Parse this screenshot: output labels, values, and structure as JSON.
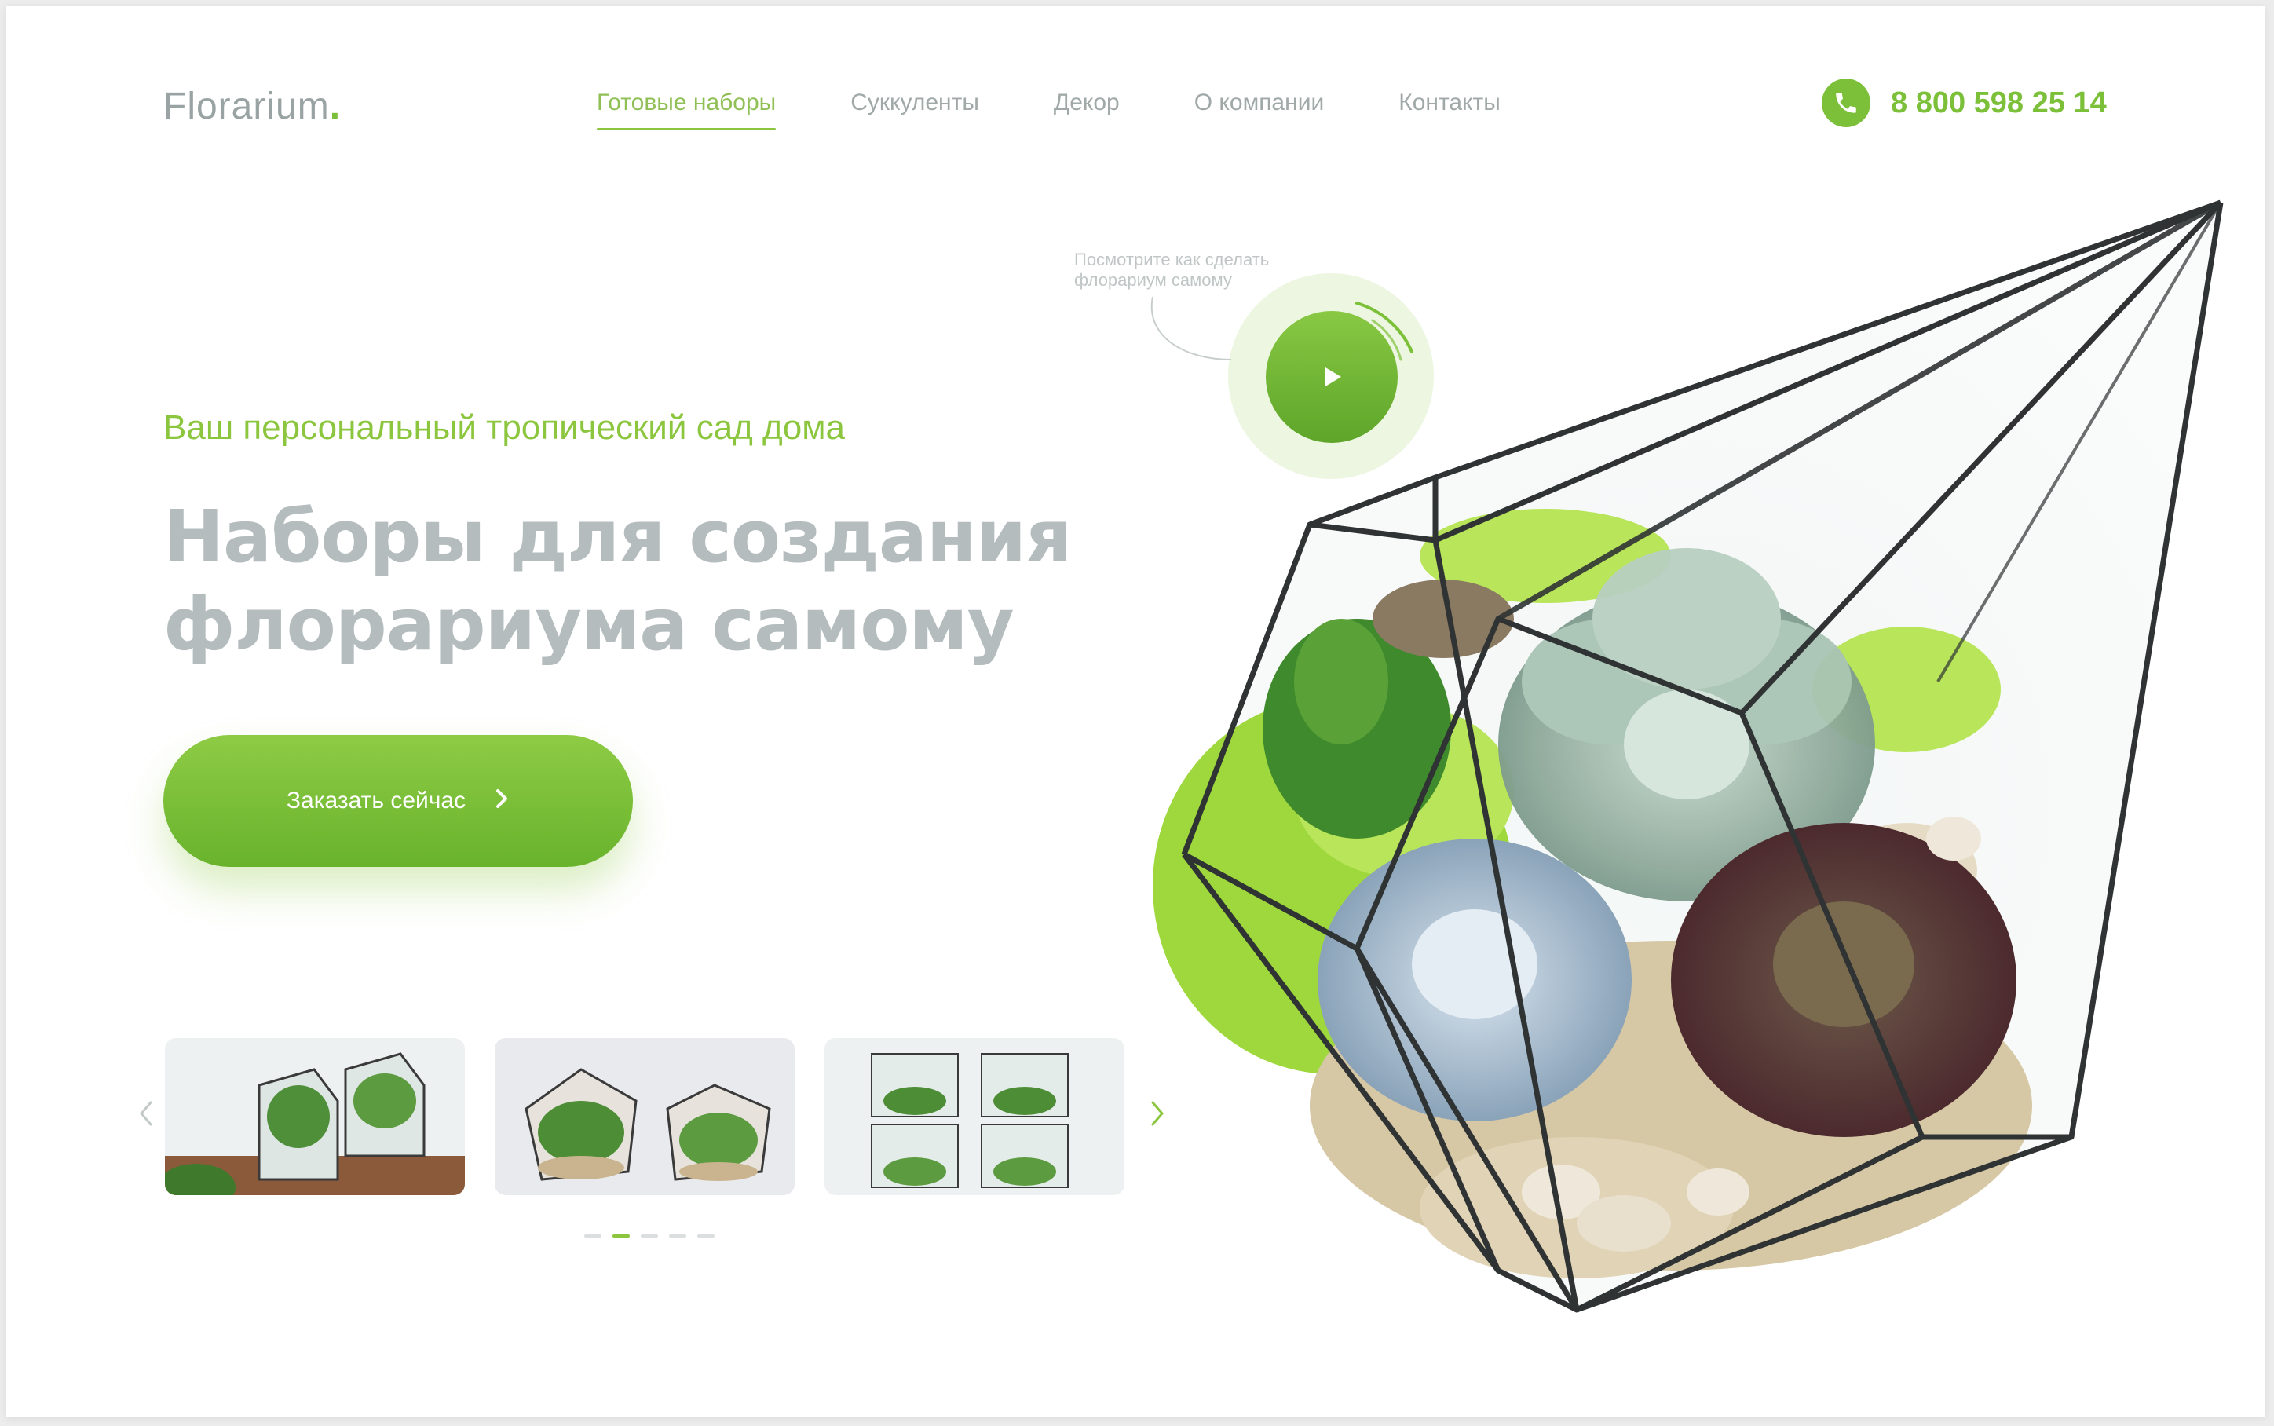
{
  "header": {
    "logo_text": "Florarium",
    "logo_dot": ".",
    "nav": [
      {
        "label": "Готовые наборы",
        "active": true
      },
      {
        "label": "Суккуленты",
        "active": false
      },
      {
        "label": "Декор",
        "active": false
      },
      {
        "label": "О компании",
        "active": false
      },
      {
        "label": "Контакты",
        "active": false
      }
    ],
    "phone": "8 800 598 25 14",
    "phone_icon": "phone-icon"
  },
  "hero": {
    "subtitle": "Ваш персональный тропический сад дома",
    "title_line1": "Наборы для создания",
    "title_line2": "флорариума самому",
    "cta_label": "Заказать сейчас",
    "cta_icon": "chevron-right-icon",
    "video_hint": "Посмотрите как сделать флорариум самому",
    "play_icon": "play-icon"
  },
  "carousel": {
    "items": [
      {
        "name": "thumbnail-1"
      },
      {
        "name": "thumbnail-2"
      },
      {
        "name": "thumbnail-3"
      }
    ],
    "prev_icon": "chevron-left-icon",
    "next_icon": "chevron-right-icon",
    "dots": 5,
    "active_dot": 2
  },
  "colors": {
    "accent": "#8cc63f",
    "accent_dark": "#69b32c",
    "text_muted": "#a0a8a8",
    "title": "#b4bcbd"
  }
}
